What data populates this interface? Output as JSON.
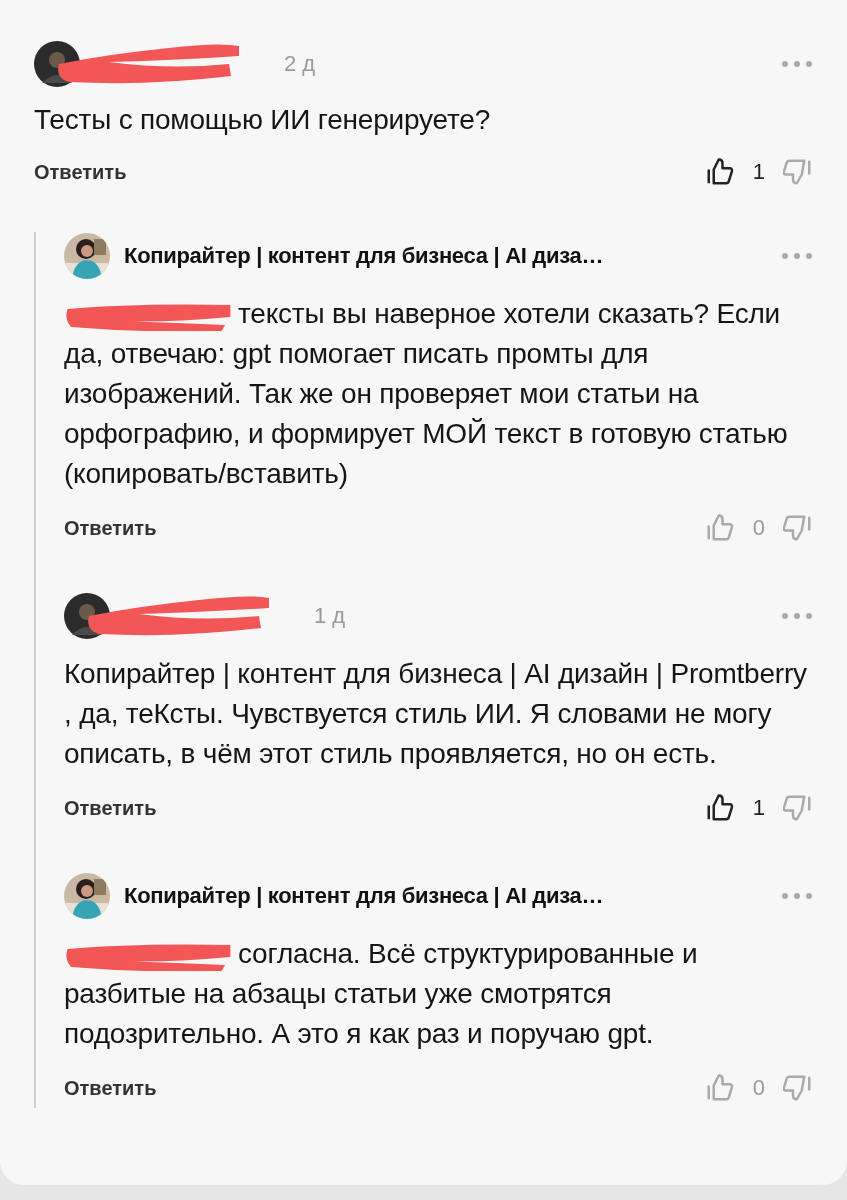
{
  "thread": {
    "comment": {
      "author_redacted": true,
      "time": "2 д",
      "text": "Тесты с помощью ИИ генерируете?",
      "reply_label": "Ответить",
      "likes": "1",
      "liked": true,
      "replies": [
        {
          "author": "Копирайтер | контент для бизнеса | AI диза…",
          "author_redacted": false,
          "mention_redacted": true,
          "text": "тексты вы наверное хотели сказать? Если да, отвечаю: gpt помогает писать промты для изображений. Так же он проверяет мои статьи на орфографию, и формирует МОЙ текст в готовую статью (копировать/вставить)",
          "reply_label": "Ответить",
          "likes": "0",
          "liked": false
        },
        {
          "author_redacted": true,
          "time": "1 д",
          "mention_redacted": false,
          "text": "Копирайтер | контент для бизнеса | AI дизайн | Promtberry , да, теКсты. Чувствуется стиль ИИ. Я словами не могу описать, в чём этот стиль проявляется, но он есть.",
          "reply_label": "Ответить",
          "likes": "1",
          "liked": true
        },
        {
          "author": "Копирайтер | контент для бизнеса | AI диза…",
          "author_redacted": false,
          "mention_redacted": true,
          "text": "согласна. Всё структурированные и разбитые на абзацы статьи уже смотрятся подозрительно. А это я как раз и поручаю gpt.",
          "reply_label": "Ответить",
          "likes": "0",
          "liked": false
        }
      ]
    }
  }
}
